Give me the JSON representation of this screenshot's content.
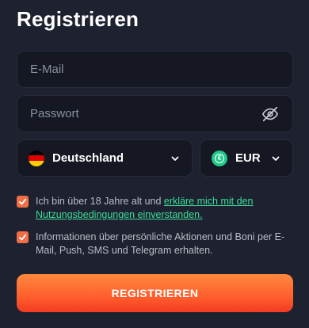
{
  "title": "Registrieren",
  "email": {
    "placeholder": "E-Mail",
    "value": ""
  },
  "password": {
    "placeholder": "Passwort",
    "value": "",
    "icon": "eye-off-icon"
  },
  "country": {
    "label": "Deutschland",
    "icon": "germany-flag-icon"
  },
  "currency": {
    "label": "EUR",
    "icon": "euro-icon"
  },
  "consent_terms": {
    "checked": true,
    "text": "Ich bin über 18 Jahre alt und ",
    "link": "erkläre mich mit den Nutzungsbedingungen einverstanden."
  },
  "consent_marketing": {
    "checked": true,
    "text": "Informationen über persönliche Aktionen und Boni per E-Mail, Push, SMS und Telegram erhalten."
  },
  "submit_label": "REGISTRIEREN",
  "colors": {
    "background": "#1e2230",
    "field": "#151823",
    "accent": "#f46d45",
    "link": "#3ddc97",
    "euro_badge": "#22c98a"
  }
}
